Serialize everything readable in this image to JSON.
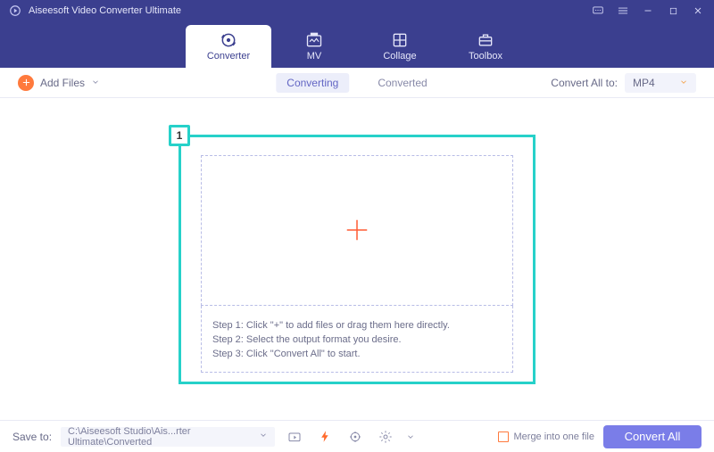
{
  "app": {
    "title": "Aiseesoft Video Converter Ultimate"
  },
  "tabs": [
    {
      "label": "Converter",
      "active": true
    },
    {
      "label": "MV"
    },
    {
      "label": "Collage"
    },
    {
      "label": "Toolbox"
    }
  ],
  "subbar": {
    "add_files_label": "Add Files",
    "converting_label": "Converting",
    "converted_label": "Converted",
    "convert_to_label": "Convert All to:",
    "format": "MP4"
  },
  "callout": {
    "badge": "1"
  },
  "steps": {
    "s1": "Step 1: Click \"+\" to add files or drag them here directly.",
    "s2": "Step 2: Select the output format you desire.",
    "s3": "Step 3: Click \"Convert All\" to start."
  },
  "footer": {
    "save_to_label": "Save to:",
    "save_path": "C:\\Aiseesoft Studio\\Ais...rter Ultimate\\Converted",
    "merge_label": "Merge into one file",
    "convert_all_label": "Convert All"
  }
}
